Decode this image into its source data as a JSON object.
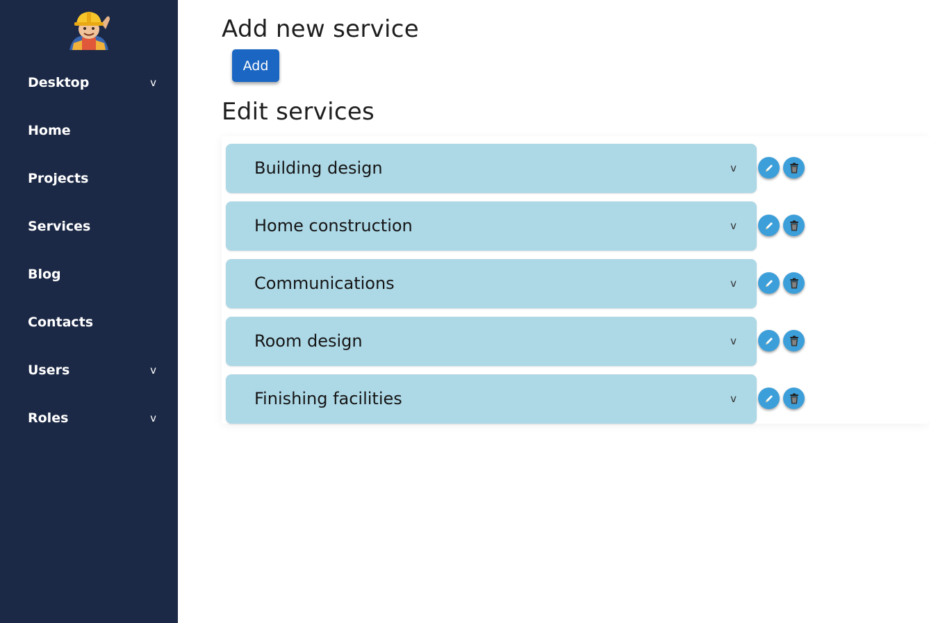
{
  "sidebar": {
    "logo": "construction-worker-mascot",
    "items": [
      {
        "label": "Desktop",
        "chevron": "v",
        "icon": "chevron-down-icon"
      },
      {
        "label": "Home"
      },
      {
        "label": "Projects"
      },
      {
        "label": "Services"
      },
      {
        "label": "Blog"
      },
      {
        "label": "Contacts"
      },
      {
        "label": "Users",
        "chevron": "v",
        "icon": "chevron-down-icon"
      },
      {
        "label": "Roles",
        "chevron": "v",
        "icon": "chevron-down-icon"
      }
    ]
  },
  "main": {
    "add_heading": "Add new service",
    "add_button": "Add",
    "edit_heading": "Edit services",
    "services": [
      {
        "title": "Building design",
        "chevron": "v"
      },
      {
        "title": "Home construction",
        "chevron": "v"
      },
      {
        "title": "Communications",
        "chevron": "v"
      },
      {
        "title": "Room design",
        "chevron": "v"
      },
      {
        "title": "Finishing facilities",
        "chevron": "v"
      }
    ],
    "row_icons": [
      "pencil-icon",
      "trash-icon"
    ]
  },
  "colors": {
    "sidebar_bg": "#1c2946",
    "accent": "#1a66c2",
    "card_bg": "#add8e6",
    "round_button": "#3d9fd9"
  }
}
